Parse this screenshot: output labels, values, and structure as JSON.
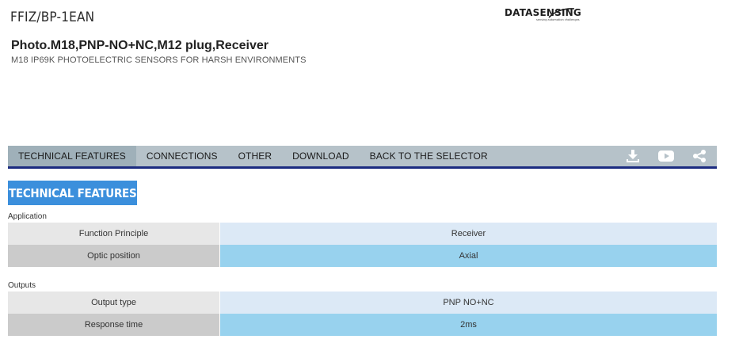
{
  "header": {
    "product_code": "FFIZ/BP-1EAN",
    "logo_text": "DATASENSING",
    "logo_tagline": "sensing automation challenges",
    "title": "Photo.M18,PNP-NO+NC,M12 plug,Receiver",
    "subtitle": "M18 IP69K PHOTOELECTRIC SENSORS FOR HARSH ENVIRONMENTS"
  },
  "nav": {
    "tabs": [
      {
        "label": "TECHNICAL FEATURES",
        "active": true
      },
      {
        "label": "CONNECTIONS",
        "active": false
      },
      {
        "label": "OTHER",
        "active": false
      },
      {
        "label": "DOWNLOAD",
        "active": false
      },
      {
        "label": "BACK TO THE SELECTOR",
        "active": false
      }
    ],
    "icons": [
      "download-icon",
      "youtube-icon",
      "share-icon"
    ]
  },
  "section": {
    "heading": "TECHNICAL FEATURES",
    "groups": [
      {
        "label": "Application",
        "rows": [
          {
            "key": "Function Principle",
            "value": "Receiver"
          },
          {
            "key": "Optic position",
            "value": "Axial"
          }
        ]
      },
      {
        "label": "Outputs",
        "rows": [
          {
            "key": "Output type",
            "value": "PNP NO+NC"
          },
          {
            "key": "Response time",
            "value": "2ms"
          }
        ]
      }
    ]
  },
  "colors": {
    "nav_bg": "#b6c2c9",
    "nav_border": "#1b2b80",
    "heading_bg": "#3b8fdc",
    "row_value_light": "#dce9f6",
    "row_value_dark": "#98d2ee"
  }
}
